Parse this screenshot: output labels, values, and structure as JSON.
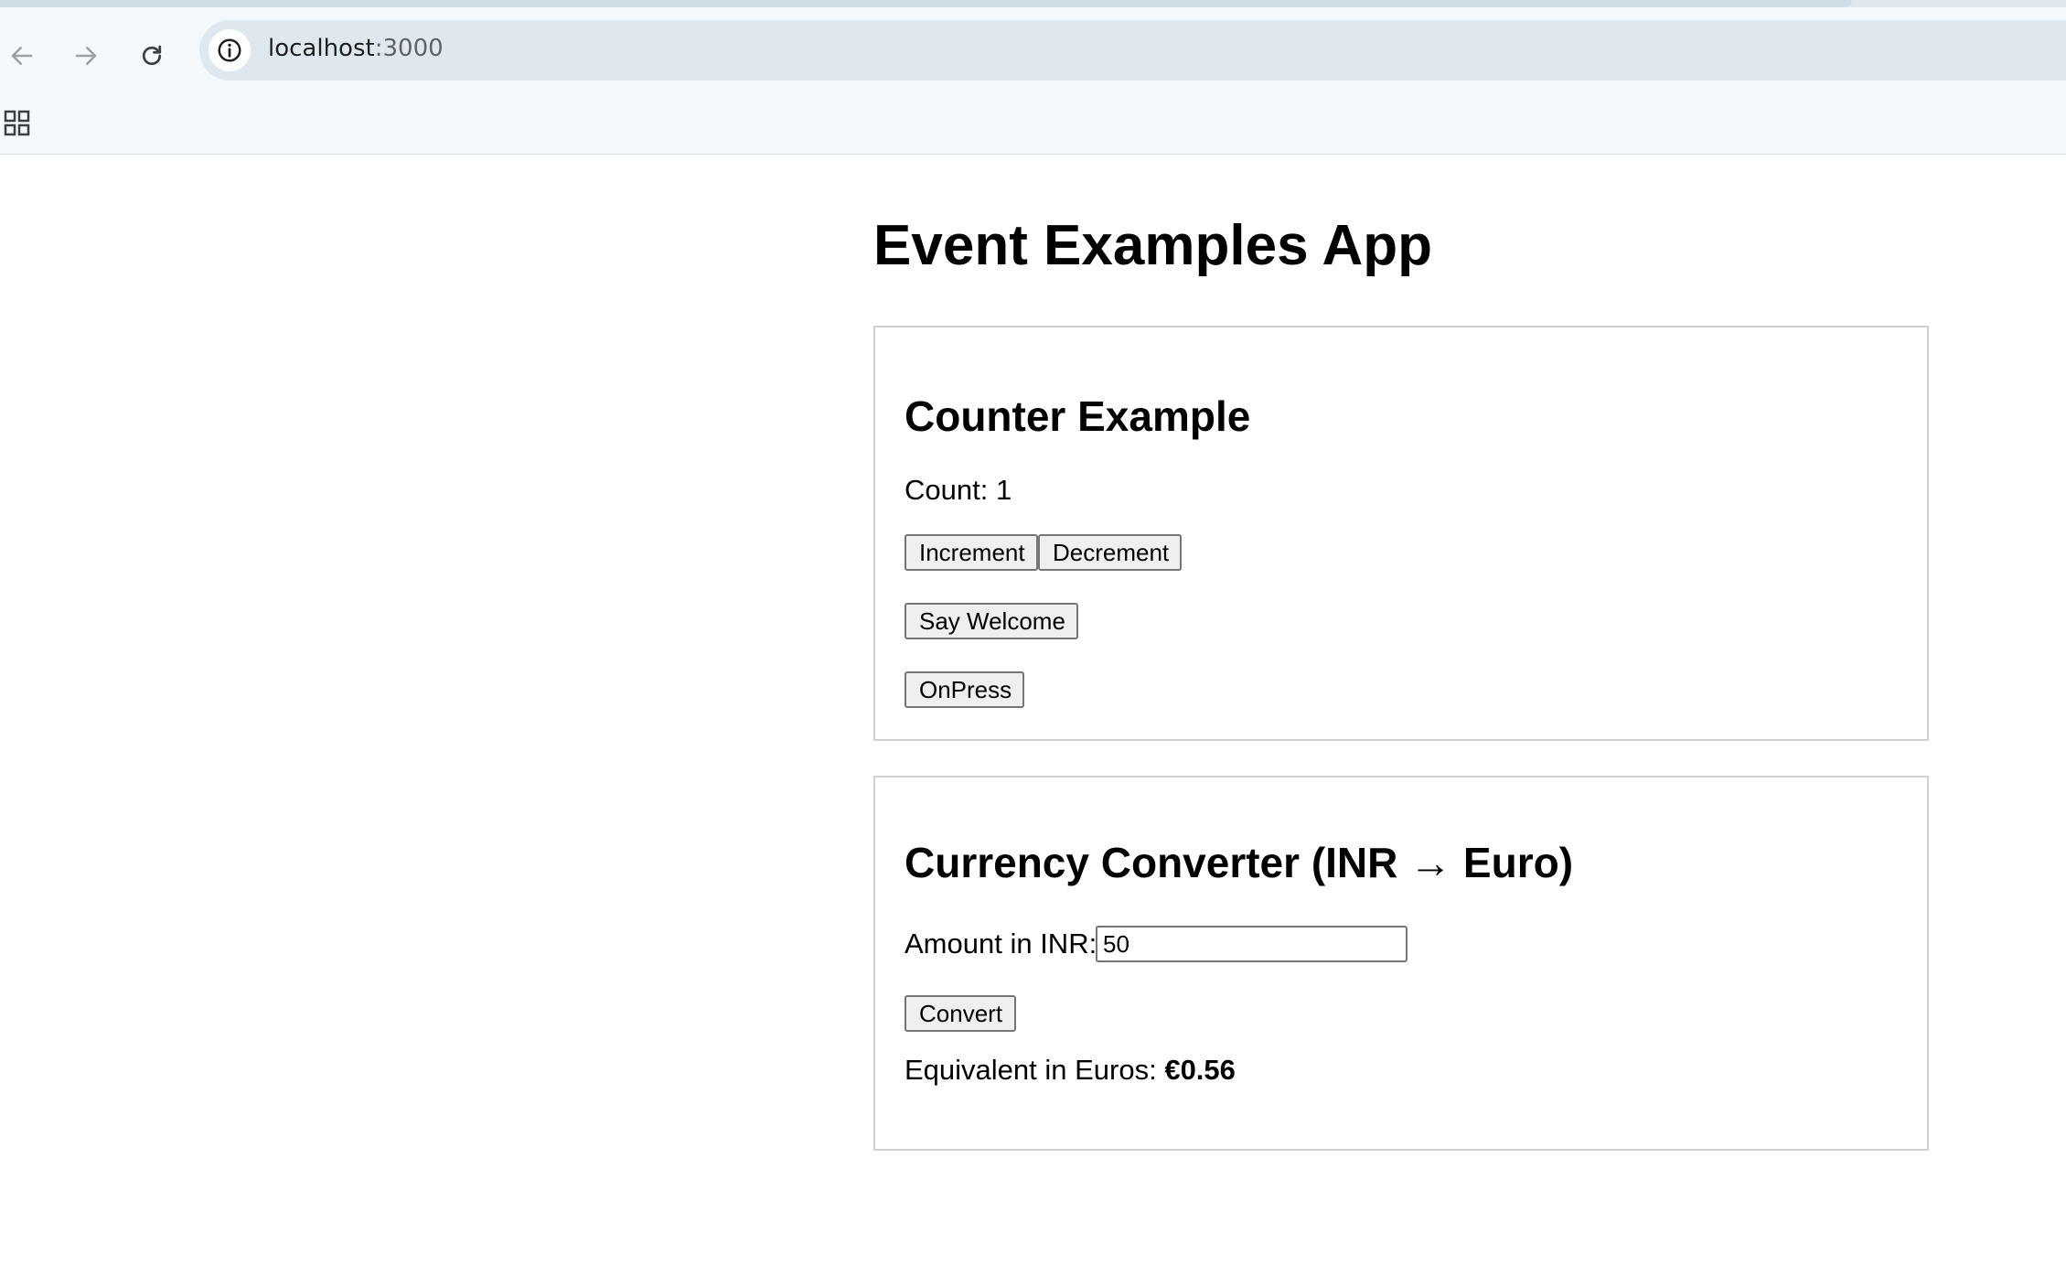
{
  "browser": {
    "url_host": "localhost",
    "url_port": ":3000"
  },
  "app": {
    "title": "Event Examples App"
  },
  "counter": {
    "heading": "Counter Example",
    "count_label": "Count: ",
    "count_value": "1",
    "increment_label": "Increment",
    "decrement_label": "Decrement",
    "welcome_label": "Say Welcome",
    "onpress_label": "OnPress"
  },
  "converter": {
    "heading": "Currency Converter (INR → Euro)",
    "amount_label": "Amount in INR:",
    "amount_value": "50",
    "convert_label": "Convert",
    "result_label": "Equivalent in Euros: ",
    "result_value": "€0.56"
  }
}
